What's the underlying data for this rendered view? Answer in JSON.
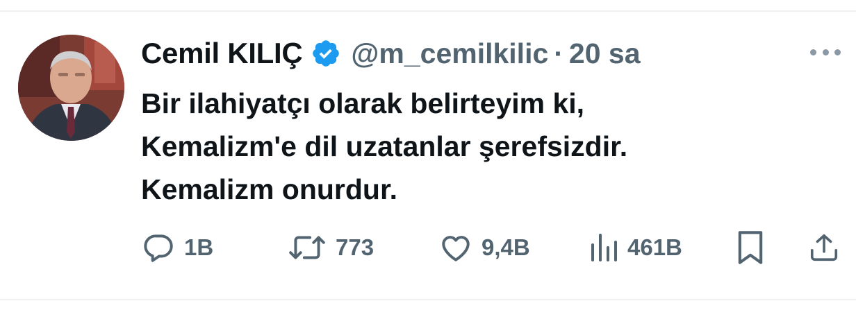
{
  "author": {
    "name": "Cemil KILIÇ",
    "handle": "@m_cemilkilic",
    "separator": "·",
    "time": "20 sa",
    "verified_color": "#1d9bf0"
  },
  "tweet": {
    "lines": [
      "Bir ilahiyatçı olarak belirteyim ki,",
      "Kemalizm'e dil uzatanlar şerefsizdir.",
      "Kemalizm onurdur."
    ]
  },
  "actions": {
    "replies": "1B",
    "retweets": "773",
    "likes": "9,4B",
    "views": "461B"
  },
  "icons": [
    "more-icon",
    "verified-badge-icon",
    "reply-icon",
    "retweet-icon",
    "like-icon",
    "views-icon",
    "bookmark-icon",
    "share-icon"
  ],
  "colors": {
    "text": "#0f1419",
    "secondary": "#536471",
    "divider": "#eff3f4"
  }
}
